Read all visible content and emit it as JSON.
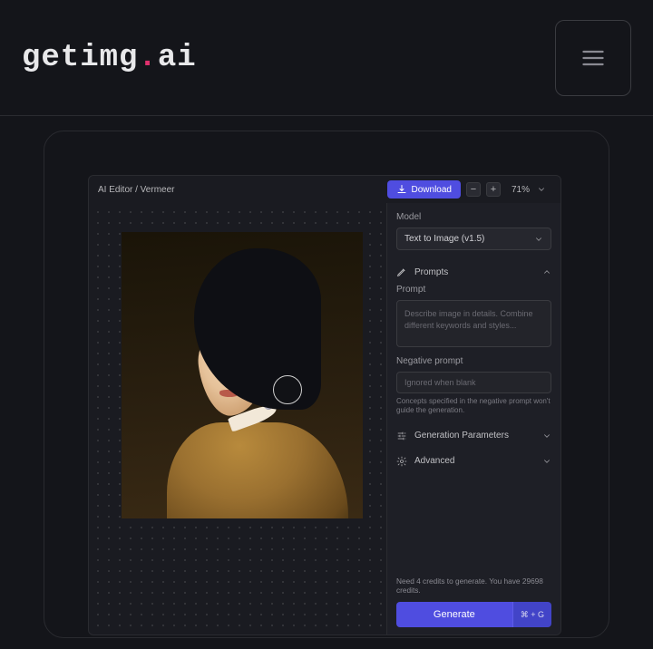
{
  "brand": {
    "pre": "getimg",
    "dot": ".",
    "post": "ai"
  },
  "breadcrumb": "AI Editor / Vermeer",
  "download_label": "Download",
  "zoom": {
    "minus": "−",
    "plus": "+",
    "pct": "71%"
  },
  "panel": {
    "model_label": "Model",
    "model_value": "Text to Image (v1.5)",
    "prompts_label": "Prompts",
    "prompt_label": "Prompt",
    "prompt_placeholder": "Describe image in details. Combine different keywords and styles...",
    "neg_label": "Negative prompt",
    "neg_placeholder": "Ignored when blank",
    "neg_hint": "Concepts specified in the negative prompt won't guide the generation.",
    "gen_params_label": "Generation Parameters",
    "advanced_label": "Advanced",
    "credits_line": "Need 4 credits to generate. You have 29698 credits.",
    "generate_label": "Generate",
    "shortcut": "⌘ + G"
  }
}
